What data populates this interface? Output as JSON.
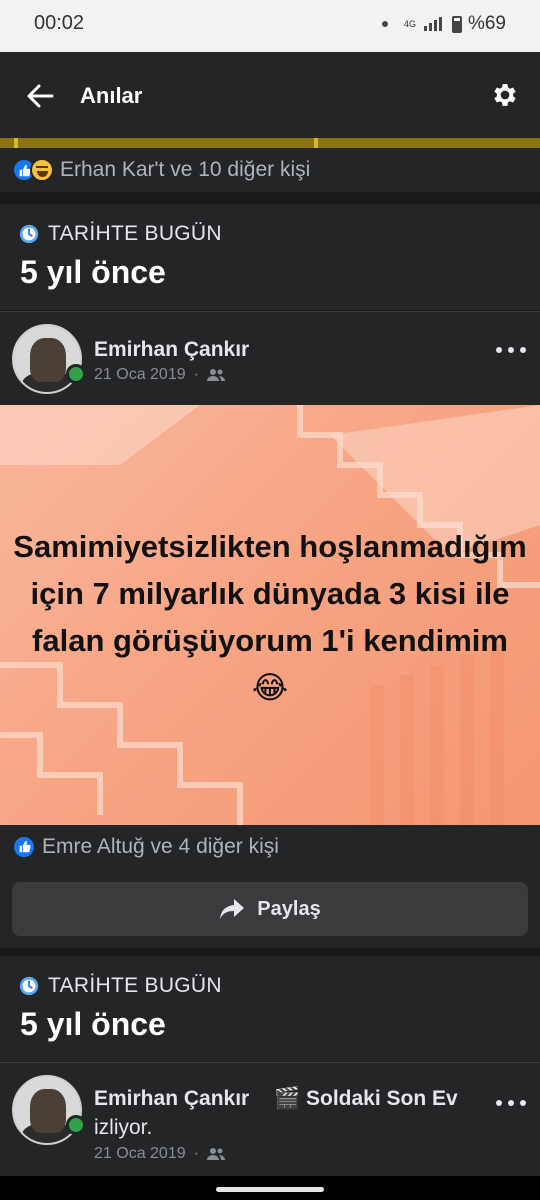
{
  "status_bar": {
    "time": "00:02",
    "network": "4G",
    "battery": "%69"
  },
  "app_bar": {
    "title": "Anılar",
    "back_icon": "back-arrow-icon",
    "settings_icon": "gear-icon"
  },
  "top_reactions": {
    "text": "Erhan Kar't ve 10 diğer kişi"
  },
  "section1": {
    "label": "TARİHTE BUGÜN",
    "years": "5 yıl önce"
  },
  "post1": {
    "author": "Emirhan Çankır",
    "date": "21 Oca 2019",
    "dot": "·",
    "text": "Samimiyetsizlikten hoşlanmadığım için 7 milyarlık dünyada 3 kisi ile falan görüşüyorum 1'i kendimim 😂",
    "reactions": "Emre Altuğ ve 4 diğer kişi",
    "share_label": "Paylaş"
  },
  "section2": {
    "label": "TARİHTE BUGÜN",
    "years": "5 yıl önce"
  },
  "post2": {
    "author": "Emirhan Çankır",
    "activity": "🎬 Soldaki Son Ev",
    "activity_suffix": "izliyor.",
    "date": "21 Oca 2019",
    "dot": "·"
  },
  "colors": {
    "background": "#18191a",
    "card": "#242526",
    "accent": "#1877f2",
    "online": "#31a24c"
  }
}
